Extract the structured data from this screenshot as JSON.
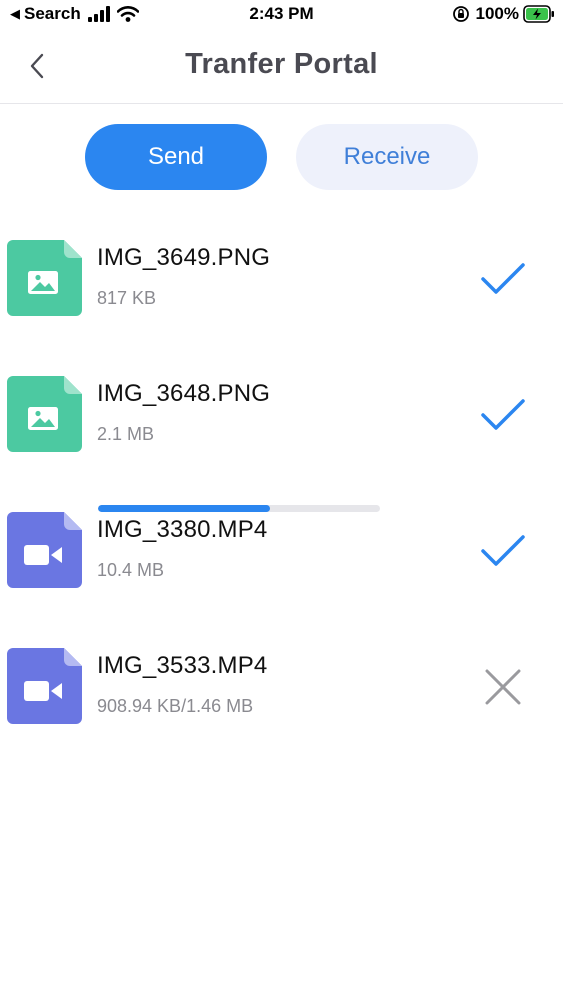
{
  "status_bar": {
    "back_app": "Search",
    "time": "2:43 PM",
    "battery": "100%"
  },
  "header": {
    "title": "Tranfer Portal"
  },
  "tabs": {
    "send": "Send",
    "receive": "Receive",
    "active": "send"
  },
  "files": [
    {
      "name": "IMG_3649.PNG",
      "size": "817 KB",
      "type": "image",
      "status": "done"
    },
    {
      "name": "IMG_3648.PNG",
      "size": "2.1 MB",
      "type": "image",
      "status": "done"
    },
    {
      "name": "IMG_3380.MP4",
      "size": "10.4 MB",
      "type": "video",
      "status": "done"
    },
    {
      "name": "IMG_3533.MP4",
      "size": "908.94 KB/1.46 MB",
      "type": "video",
      "status": "in-progress",
      "progress": 0.61
    }
  ],
  "colors": {
    "accent": "#2b86f0",
    "image_file": "#4cc9a1",
    "video_file": "#6a76e2",
    "cancel": "#9a9a9e"
  }
}
